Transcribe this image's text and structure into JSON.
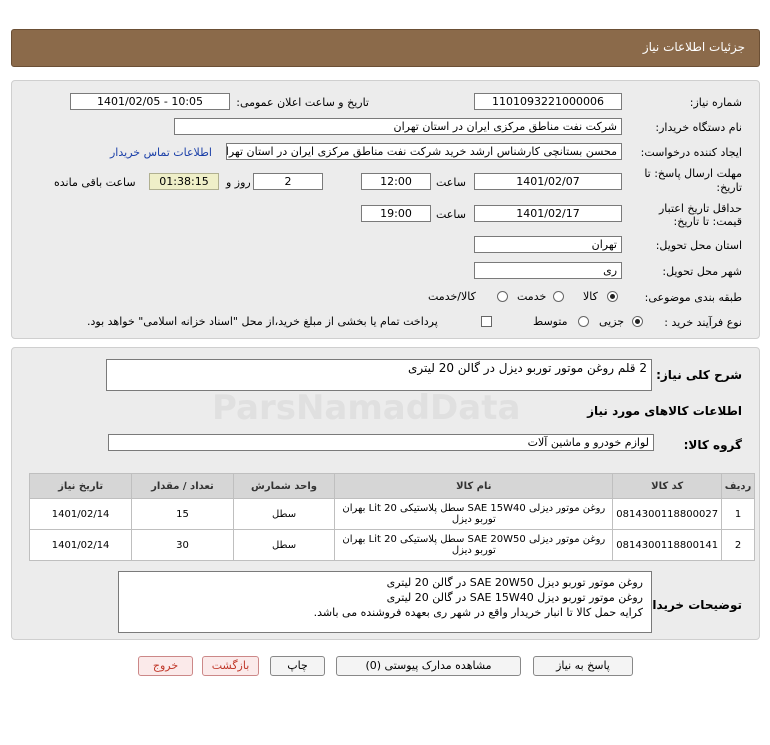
{
  "page": {
    "title": "جزئیات اطلاعات نیاز"
  },
  "info": {
    "need_number_label": "شماره نیاز:",
    "need_number": "1101093221000006",
    "announce_label": "تاریخ و ساعت اعلان عمومی:",
    "announce_value": "1401/02/05 - 10:05",
    "buyer_label": "نام دستگاه خریدار:",
    "buyer_value": "شرکت نفت مناطق مرکزی ایران در استان تهران",
    "creator_label": "ایجاد کننده درخواست:",
    "creator_value": "محسن بستانچی کارشناس ارشد خرید شرکت نفت مناطق مرکزی ایران در استان تهران",
    "contact_link": "اطلاعات تماس خریدار",
    "deadline_label_1": "مهلت ارسال پاسخ: تا",
    "deadline_label_2": "تاریخ:",
    "deadline_date": "1401/02/07",
    "time_label": "ساعت",
    "deadline_time": "12:00",
    "days_value": "2",
    "days_label": "روز و",
    "remaining_time": "01:38:15",
    "remaining_label": "ساعت باقی مانده",
    "validity_label_1": "حداقل تاریخ اعتبار",
    "validity_label_2": "قیمت: تا تاریخ:",
    "validity_date": "1401/02/17",
    "validity_time": "19:00",
    "province_label": "استان محل تحویل:",
    "province_value": "تهران",
    "city_label": "شهر محل تحویل:",
    "city_value": "ری",
    "category_label": "طبقه بندی موضوعی:",
    "category_options": [
      "کالا",
      "خدمت",
      "کالا/خدمت"
    ],
    "process_label": "نوع فرآیند خرید :",
    "process_options": [
      "جزیی",
      "متوسط"
    ],
    "payment_note": "پرداخت تمام یا بخشی از مبلغ خرید،از محل \"اسناد خزانه اسلامی\" خواهد بود."
  },
  "need": {
    "summary_label": "شرح کلی نیاز:",
    "summary_value": "2 قلم روغن موتور توربو دیزل در گالن 20 لیتری",
    "goods_info_title": "اطلاعات کالاهای مورد نیاز",
    "group_label": "گروه کالا:",
    "group_value": "لوازم خودرو و ماشین آلات"
  },
  "table": {
    "headers": [
      "ردیف",
      "کد کالا",
      "نام کالا",
      "واحد شمارش",
      "تعداد / مقدار",
      "تاریخ نیاز"
    ],
    "rows": [
      {
        "idx": "1",
        "code": "0814300118800027",
        "name": "روغن موتور دیزلی SAE 15W40 سطل پلاستیکی 20 Lit بهران توربو دیزل",
        "unit": "سطل",
        "qty": "15",
        "date": "1401/02/14"
      },
      {
        "idx": "2",
        "code": "0814300118800141",
        "name": "روغن موتور دیزلی SAE 20W50 سطل پلاستیکی 20 Lit بهران توربو دیزل",
        "unit": "سطل",
        "qty": "30",
        "date": "1401/02/14"
      }
    ]
  },
  "buyer_notes": {
    "label": "توضیحات خریدار:",
    "lines": [
      "روغن موتور توربو دیزل  SAE 20W50 در گالن 20 لیتری",
      "روغن موتور توربو دیزل   SAE 15W40 در گالن 20 لیتری",
      "کرایه حمل کالا تا انبار خریدار واقع در شهر ری بعهده فروشنده می باشد."
    ]
  },
  "buttons": {
    "reply": "پاسخ به نیاز",
    "view_docs": "مشاهده مدارک پیوستی (0)",
    "print": "چاپ",
    "back": "بازگشت",
    "exit": "خروج"
  }
}
